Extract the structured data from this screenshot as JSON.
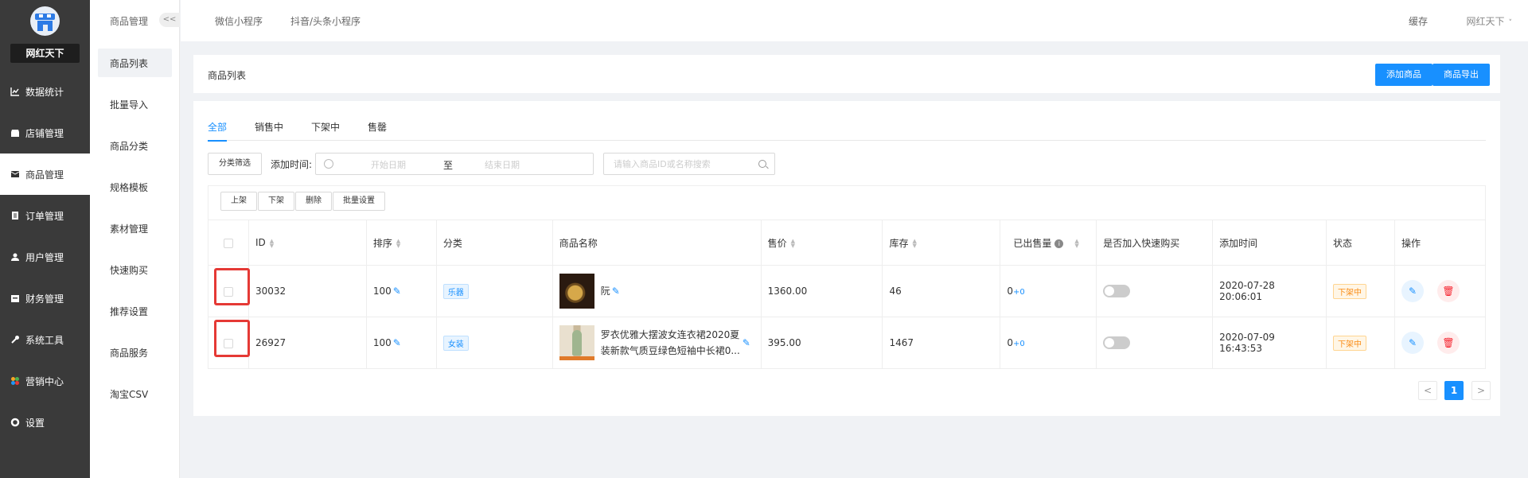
{
  "sidebar": {
    "brand": "网红天下",
    "items": [
      {
        "label": "数据统计",
        "icon": "chart-icon"
      },
      {
        "label": "店铺管理",
        "icon": "shop-icon"
      },
      {
        "label": "商品管理",
        "icon": "goods-icon"
      },
      {
        "label": "订单管理",
        "icon": "order-icon"
      },
      {
        "label": "用户管理",
        "icon": "user-icon"
      },
      {
        "label": "财务管理",
        "icon": "finance-icon"
      },
      {
        "label": "系统工具",
        "icon": "wrench-icon"
      },
      {
        "label": "营销中心",
        "icon": "marketing-icon"
      },
      {
        "label": "设置",
        "icon": "gear-icon"
      }
    ],
    "active": "商品管理"
  },
  "subnav": {
    "title": "商品管理",
    "collapse": "<<",
    "items": [
      "商品列表",
      "批量导入",
      "商品分类",
      "规格模板",
      "素材管理",
      "快速购买",
      "推荐设置",
      "商品服务",
      "淘宝CSV"
    ],
    "active": "商品列表"
  },
  "topbar": {
    "tabs": [
      "微信小程序",
      "抖音/头条小程序"
    ],
    "cache": "缓存",
    "user": "网红天下"
  },
  "title_card": {
    "title": "商品列表",
    "add_button": "添加商品",
    "export_button": "商品导出"
  },
  "tabs": [
    "全部",
    "销售中",
    "下架中",
    "售罄"
  ],
  "filters": {
    "category_button": "分类筛选",
    "time_label": "添加时间:",
    "start_placeholder": "开始日期",
    "to": "至",
    "end_placeholder": "结束日期",
    "search_placeholder": "请输入商品ID或名称搜索"
  },
  "batch": {
    "on_shelf": "上架",
    "off_shelf": "下架",
    "delete": "删除",
    "batch_set": "批量设置"
  },
  "table": {
    "headers": [
      "ID",
      "排序",
      "分类",
      "商品名称",
      "售价",
      "库存",
      "已出售量",
      "是否加入快速购买",
      "添加时间",
      "状态",
      "操作"
    ],
    "rows": [
      {
        "id": "30032",
        "sort": "100",
        "category": "乐器",
        "name": "阮",
        "price": "1360.00",
        "stock": "46",
        "sold": "0",
        "sold_extra": "+0",
        "time": "2020-07-28 20:06:01",
        "status": "下架中"
      },
      {
        "id": "26927",
        "sort": "100",
        "category": "女装",
        "name": "罗衣优雅大摆波女连衣裙2020夏装新款气质豆绿色短袖中长裙0...",
        "price": "395.00",
        "stock": "1467",
        "sold": "0",
        "sold_extra": "+0",
        "time": "2020-07-09 16:43:53",
        "status": "下架中"
      }
    ]
  },
  "pagination": {
    "prev": "<",
    "current": "1",
    "next": ">"
  },
  "colors": {
    "accent": "#1890ff",
    "sidebar": "#3a3a3a",
    "highlight": "#e53935"
  }
}
